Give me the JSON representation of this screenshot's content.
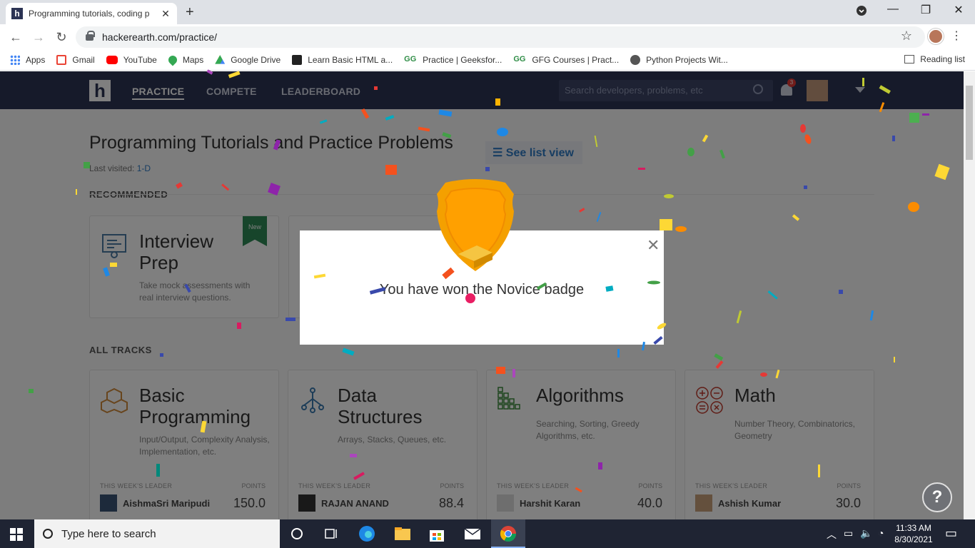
{
  "browser": {
    "tab_title": "Programming tutorials, coding p",
    "tab_favicon": "h",
    "new_tab_glyph": "+",
    "url": "hackerearth.com/practice/",
    "bookmarks": [
      "Apps",
      "Gmail",
      "YouTube",
      "Maps",
      "Google Drive",
      "Learn Basic HTML a...",
      "Practice | Geeksfor...",
      "GFG Courses | Pract...",
      "Python Projects Wit..."
    ],
    "reading_list": "Reading list"
  },
  "site": {
    "logo": "h",
    "nav": [
      "PRACTICE",
      "COMPETE",
      "LEADERBOARD"
    ],
    "search_placeholder": "Search developers, problems, etc",
    "notification_count": "3",
    "page_title": "Programming Tutorials and Practice Problems",
    "last_visited_label": "Last visited:",
    "last_visited_link": "1-D",
    "list_view_button": "☰ See list view",
    "recommended_heading": "RECOMMENDED",
    "all_tracks_heading": "ALL TRACKS",
    "recommended_card": {
      "title_line1": "Interview",
      "title_line2": "Prep",
      "desc_line1": "Take mock assessments with",
      "desc_line2": "real interview questions.",
      "ribbon": "New"
    },
    "tracks": [
      {
        "title1": "Basic",
        "title2": "Programming",
        "desc1": "Input/Output, Complexity Analysis,",
        "desc2": "Implementation, etc.",
        "leader": "AishmaSri Maripudi",
        "points": "150.0"
      },
      {
        "title1": "Data",
        "title2": "Structures",
        "desc1": "Arrays, Stacks, Queues, etc.",
        "desc2": "",
        "leader": "RAJAN ANAND",
        "points": "88.4"
      },
      {
        "title1": "Algorithms",
        "title2": "",
        "desc1": "Searching, Sorting, Greedy",
        "desc2": "Algorithms, etc.",
        "leader": "Harshit Karan",
        "points": "40.0"
      },
      {
        "title1": "Math",
        "title2": "",
        "desc1": "Number Theory, Combinatorics,",
        "desc2": "Geometry",
        "leader": "Ashish Kumar",
        "points": "30.0"
      }
    ],
    "leader_label": "THIS WEEK'S LEADER",
    "points_label": "POINTS",
    "help_glyph": "?"
  },
  "modal": {
    "message": "You have won the Novice badge",
    "close_glyph": "✕"
  },
  "taskbar": {
    "search_placeholder": "Type here to search",
    "time": "11:33 AM",
    "date": "8/30/2021"
  },
  "colors": {
    "site_nav": "#2c3454",
    "badge_orange": "#ffa000",
    "link_blue": "#2f7ac5"
  }
}
